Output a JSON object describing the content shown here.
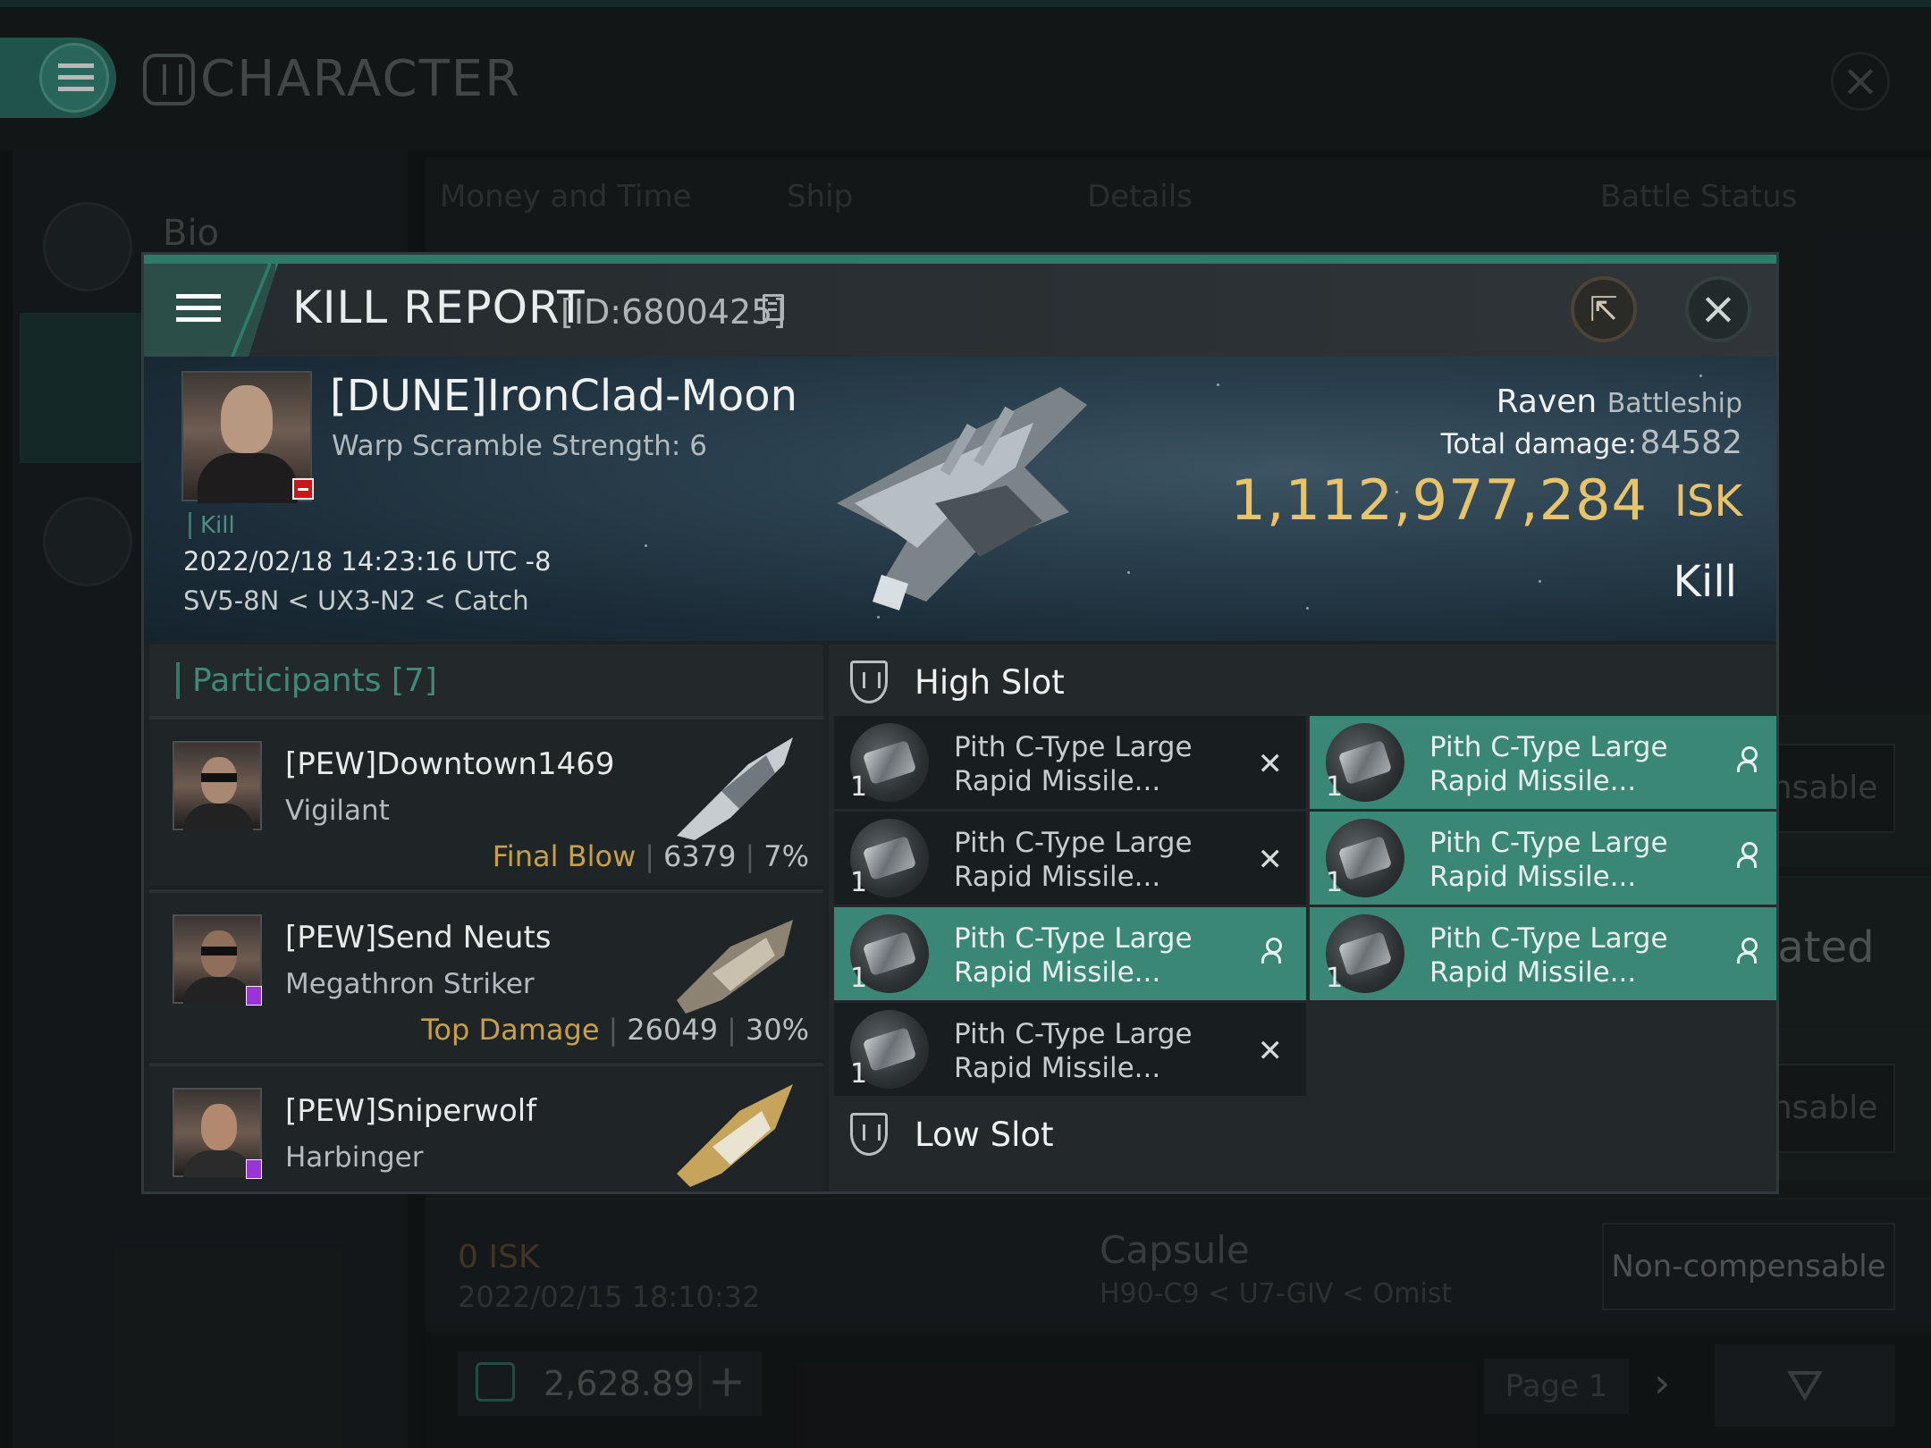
{
  "app": {
    "title": "CHARACTER",
    "sidebar": {
      "bio_label": "Bio"
    },
    "tabs": [
      "Money and Time",
      "Ship",
      "Details",
      "Battle Status"
    ],
    "bg_rows": [
      {
        "button": "ensable"
      },
      {
        "button": "sated"
      },
      {
        "button": "ensable"
      }
    ],
    "bottom_row": {
      "isk": "0  ISK",
      "date": "2022/02/15  18:10:32",
      "ship": "Capsule",
      "path": "H90-C9 < U7-GIV < Omist",
      "button": "Non-compensable"
    },
    "footer": {
      "currency_value": "2,628.89",
      "plus": "+",
      "page_label": "Page 1",
      "next": "›"
    }
  },
  "kill_report": {
    "title": "KILL REPORT",
    "id_label": "[ID:6800425]",
    "share_icon": "share-icon",
    "close_icon": "close-icon",
    "victim": {
      "name": "[DUNE]IronClad-Moon",
      "warp_scramble": "Warp Scramble Strength: 6",
      "kind": "Kill",
      "datetime": "2022/02/18 14:23:16 UTC -8",
      "location": "SV5-8N < UX3-N2 < Catch",
      "ship_name": "Raven",
      "ship_class": "Battleship",
      "total_damage_label": "Total damage:",
      "total_damage": "84582",
      "isk_value": "1,112,977,284",
      "isk_unit": "ISK",
      "result": "Kill"
    },
    "participants": {
      "header": "Participants [7]",
      "rows": [
        {
          "name": "[PEW]Downtown1469",
          "ship": "Vigilant",
          "tag": "Final Blow",
          "damage": "6379",
          "percent": "7%"
        },
        {
          "name": "[PEW]Send Neuts",
          "ship": "Megathron Striker",
          "tag": "Top Damage",
          "damage": "26049",
          "percent": "30%"
        },
        {
          "name": "[PEW]Sniperwolf",
          "ship": "Harbinger"
        }
      ]
    },
    "slots": {
      "high_title": "High Slot",
      "low_title": "Low Slot",
      "items": [
        {
          "line1": "Pith C-Type Large",
          "line2": "Rapid Missile...",
          "qty": "1",
          "status": "destroyed",
          "mark": "✕"
        },
        {
          "line1": "Pith C-Type Large",
          "line2": "Rapid Missile...",
          "qty": "1",
          "status": "dropped"
        },
        {
          "line1": "Pith C-Type Large",
          "line2": "Rapid Missile...",
          "qty": "1",
          "status": "destroyed",
          "mark": "✕"
        },
        {
          "line1": "Pith C-Type Large",
          "line2": "Rapid Missile...",
          "qty": "1",
          "status": "dropped"
        },
        {
          "line1": "Pith C-Type Large",
          "line2": "Rapid Missile...",
          "qty": "1",
          "status": "dropped"
        },
        {
          "line1": "Pith C-Type Large",
          "line2": "Rapid Missile...",
          "qty": "1",
          "status": "dropped"
        },
        {
          "line1": "Pith C-Type Large",
          "line2": "Rapid Missile...",
          "qty": "1",
          "status": "destroyed",
          "mark": "✕"
        }
      ]
    },
    "colors": {
      "accent": "#2e7a6b",
      "dropped_bg": "#3b8776",
      "isk_gold": "#e7c36b",
      "tag_gold": "#c8a04a"
    }
  }
}
